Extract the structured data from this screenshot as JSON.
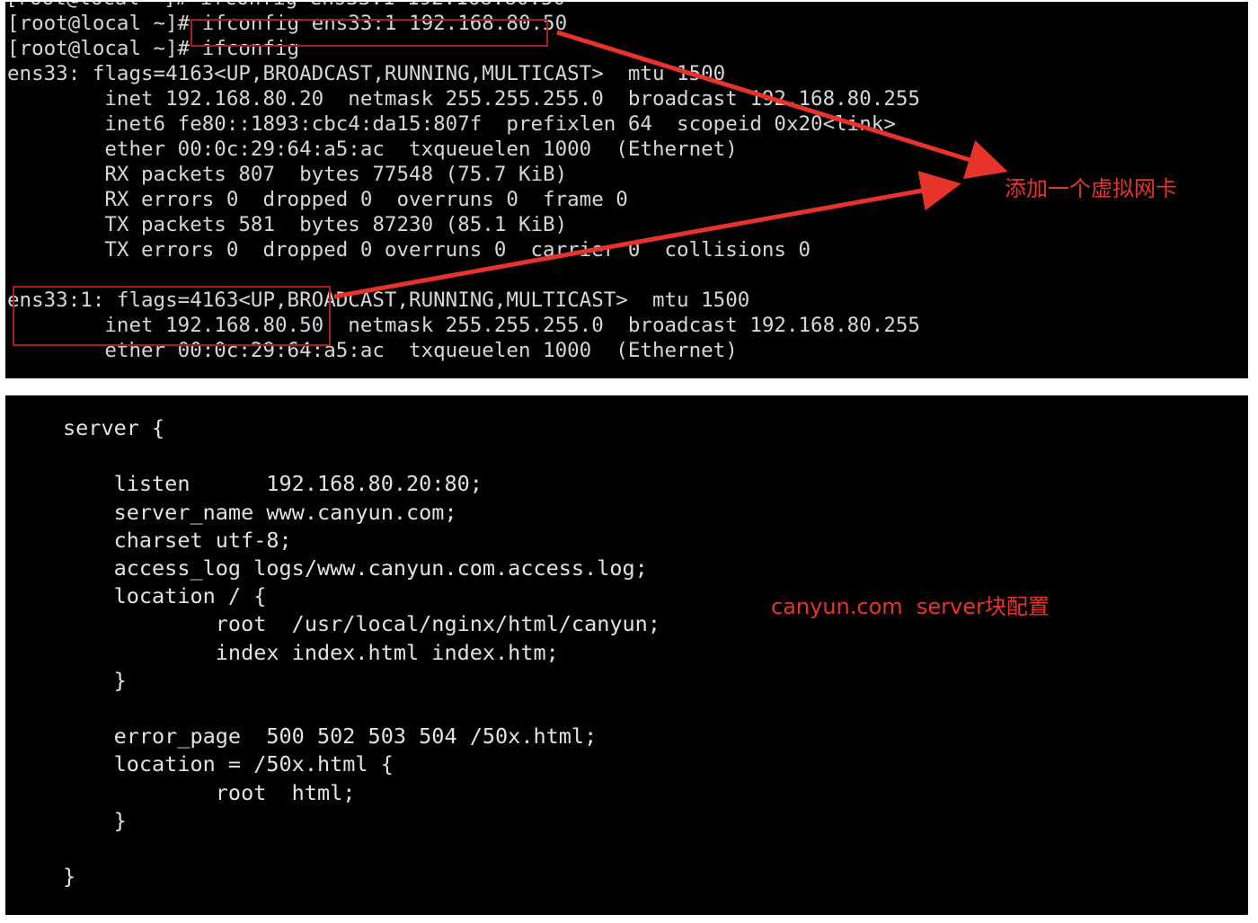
{
  "terminal": {
    "background": "#000000",
    "foreground": "#d6d6d6",
    "clipped_top_line": "[root@local ~]# ifconfig ens33:1 192.168.80.50",
    "lines": [
      "[root@local ~]# ifconfig ens33:1 192.168.80.50",
      "[root@local ~]# ifconfig",
      "ens33: flags=4163<UP,BROADCAST,RUNNING,MULTICAST>  mtu 1500",
      "        inet 192.168.80.20  netmask 255.255.255.0  broadcast 192.168.80.255",
      "        inet6 fe80::1893:cbc4:da15:807f  prefixlen 64  scopeid 0x20<link>",
      "        ether 00:0c:29:64:a5:ac  txqueuelen 1000  (Ethernet)",
      "        RX packets 807  bytes 77548 (75.7 KiB)",
      "        RX errors 0  dropped 0  overruns 0  frame 0",
      "        TX packets 581  bytes 87230 (85.1 KiB)",
      "        TX errors 0  dropped 0 overruns 0  carrier 0  collisions 0",
      "",
      "ens33:1: flags=4163<UP,BROADCAST,RUNNING,MULTICAST>  mtu 1500",
      "        inet 192.168.80.50  netmask 255.255.255.0  broadcast 192.168.80.255",
      "        ether 00:0c:29:64:a5:ac  txqueuelen 1000  (Ethernet)"
    ]
  },
  "config": {
    "background": "#000000",
    "foreground": "#e2e2e2",
    "lines": [
      "server {",
      "",
      "    listen      192.168.80.20:80;",
      "    server_name www.canyun.com;",
      "    charset utf-8;",
      "    access_log logs/www.canyun.com.access.log;",
      "    location / {",
      "            root  /usr/local/nginx/html/canyun;",
      "            index index.html index.htm;",
      "    }",
      "",
      "    error_page  500 502 503 504 /50x.html;",
      "    location = /50x.html {",
      "            root  html;",
      "    }",
      "",
      "}"
    ]
  },
  "annotations": {
    "color": "#e8332a",
    "box_color": "#a32020",
    "virtual_nic_label": "添加一个虚拟网卡",
    "server_block_label": "canyun.com  server块配置",
    "boxed_command": "ifconfig ens33:1 192.168.80.50",
    "boxed_interface": "ens33:1 inet 192.168.80.50"
  }
}
